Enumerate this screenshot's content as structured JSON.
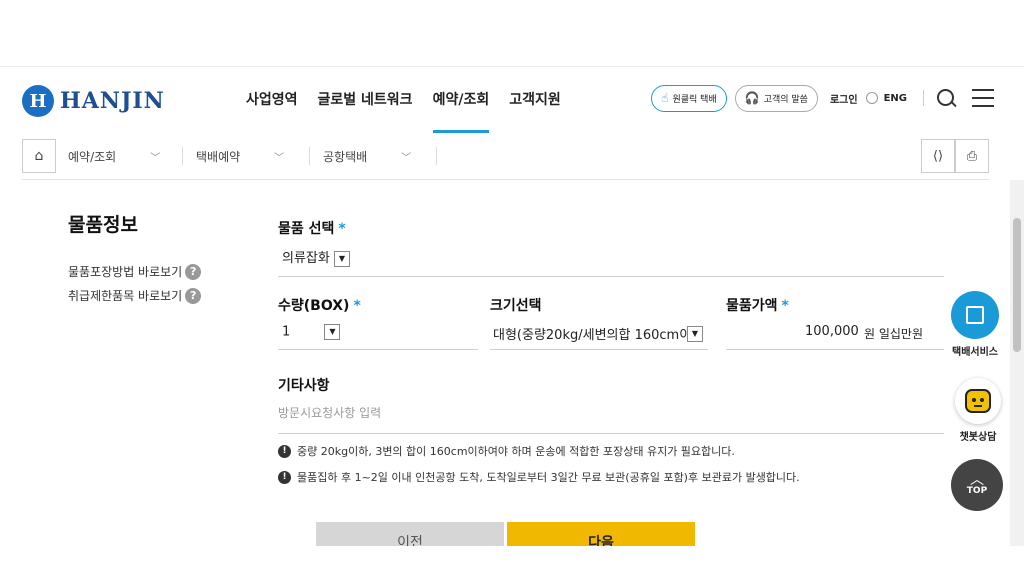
{
  "brand": {
    "logo_mark": "H",
    "logo_text": "HANJIN",
    "color": "#1d4f91"
  },
  "nav": {
    "items": [
      {
        "label": "사업영역"
      },
      {
        "label": "글로벌 네트워크"
      },
      {
        "label": "예약/조회"
      },
      {
        "label": "고객지원"
      }
    ],
    "active_index": 2
  },
  "util": {
    "oneclick_label": "원클릭 택배",
    "voice_label": "고객의 말씀",
    "login_label": "로그인",
    "lang_label": "ENG"
  },
  "breadcrumb": {
    "items": [
      {
        "label": "예약/조회"
      },
      {
        "label": "택배예약"
      },
      {
        "label": "공항택배"
      }
    ]
  },
  "side": {
    "title": "물품정보",
    "links": [
      {
        "label": "물품포장방법 바로보기"
      },
      {
        "label": "취급제한품목 바로보기"
      }
    ],
    "qmark": "?"
  },
  "form": {
    "item_select": {
      "label": "물품 선택",
      "value": "의류잡화"
    },
    "quantity": {
      "label": "수량(BOX)",
      "value": "1"
    },
    "size": {
      "label": "크기선택",
      "value": "대형(중량20kg/세변의합 160cm이"
    },
    "price": {
      "label": "물품가액",
      "value": "100,000",
      "unit": "원 일십만원"
    },
    "etc": {
      "label": "기타사항",
      "placeholder": "방문시요청사항 입력"
    },
    "required_mark": "*",
    "dropdown_arrow": "▼"
  },
  "notes": [
    {
      "icon": "!",
      "text": "중량 20kg이하, 3변의 합이 160cm이하여야 하며 운송에 적합한 포장상태 유지가 필요합니다."
    },
    {
      "icon": "!",
      "text": "물품집하 후 1~2일 이내 인천공항 도착, 도착일로부터 3일간 무료 보관(공휴일 포함)후 보관료가 발생합니다."
    }
  ],
  "buttons": {
    "prev": "이전",
    "next": "다음"
  },
  "floating": {
    "parcel_label": "택배서비스",
    "chatbot_label": "챗봇상담",
    "top_label": "TOP"
  },
  "colors": {
    "accent": "#1a9bd7",
    "next_button": "#f0b800",
    "prev_button": "#d6d6d6"
  }
}
